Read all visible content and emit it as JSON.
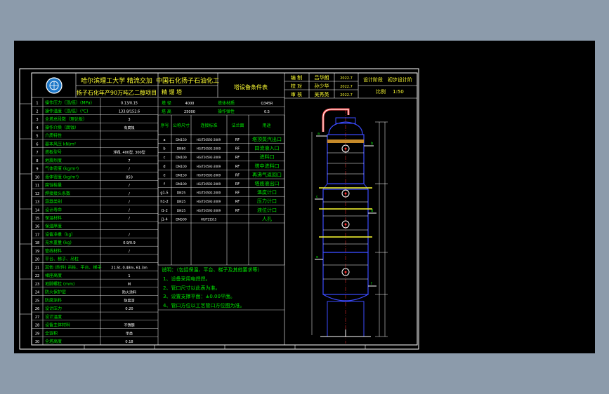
{
  "colors": {
    "background": "#8c9bab",
    "canvas": "#000000",
    "frame": "#ffffff",
    "text": "#00e600",
    "header_text": "#ffff33",
    "vessel": "#3b4bff",
    "nozzle": "#ff3030"
  },
  "title_block": {
    "university": "哈尔滨理工大学 精流交加",
    "company": "中国石化扬子石油化工",
    "project": "扬子石化年产90万吨乙二醇项目",
    "drawing_no": "精 馏 塔",
    "sheet_title": "塔设备条件表",
    "signoff": [
      {
        "role": "编 制",
        "name": "吕华朗",
        "date": "2022.7"
      },
      {
        "role": "校 对",
        "name": "孙少华",
        "date": "2022.7"
      },
      {
        "role": "审 核",
        "name": "吴秀英",
        "date": "2022.7"
      }
    ],
    "stage": "设计阶段　初步设计阶",
    "scale_label": "比例",
    "scale_value": "1:50"
  },
  "left_table": [
    {
      "no": "1",
      "label": "操作压力（顶/底）(MPa)",
      "value": "0.13/0.15"
    },
    {
      "no": "2",
      "label": "操作温度（顶/底）(℃)",
      "value": "133.8/152.6"
    },
    {
      "no": "3",
      "label": "全塔总段数（理论板）",
      "value": "3"
    },
    {
      "no": "4",
      "label": "操作介质（腐蚀）",
      "value": "有腐蚀"
    },
    {
      "no": "5",
      "label": "介质特性",
      "value": ""
    },
    {
      "no": "6",
      "label": "基本风压 kN/m²",
      "value": ""
    },
    {
      "no": "7",
      "label": "塔板型号",
      "value": "浮阀, 400型, 300型"
    },
    {
      "no": "8",
      "label": "地震烈度",
      "value": "7"
    },
    {
      "no": "9",
      "label": "气体密度 (kg/m³)",
      "value": "/"
    },
    {
      "no": "10",
      "label": "液体密度 (kg/m³)",
      "value": "850"
    },
    {
      "no": "11",
      "label": "腐蚀裕量",
      "value": "/"
    },
    {
      "no": "12",
      "label": "焊接接头系数",
      "value": "/"
    },
    {
      "no": "13",
      "label": "容器类别",
      "value": "/"
    },
    {
      "no": "14",
      "label": "设计寿命",
      "value": "/"
    },
    {
      "no": "15",
      "label": "保温材料",
      "value": "/"
    },
    {
      "no": "16",
      "label": "保温厚度",
      "value": ""
    },
    {
      "no": "17",
      "label": "设备净重（kg）",
      "value": "/"
    },
    {
      "no": "18",
      "label": "充水重量 (kg)",
      "value": "0.9/0.9"
    },
    {
      "no": "19",
      "label": "管线材料",
      "value": "/"
    },
    {
      "no": "20",
      "label": "平台、梯子、吊柱",
      "value": ""
    },
    {
      "no": "21",
      "label": "其他 (附件) 吊柱、平台、梯子",
      "value": "21.5t, 0.48m, 61.3m"
    },
    {
      "no": "22",
      "label": "裙座高度",
      "value": "1"
    },
    {
      "no": "23",
      "label": "地脚螺栓 (mm)",
      "value": "M"
    },
    {
      "no": "24",
      "label": "防火保护层",
      "value": "防火涂料"
    },
    {
      "no": "25",
      "label": "防腐涂料",
      "value": "防腐漆"
    },
    {
      "no": "26",
      "label": "设计压力",
      "value": "0.20"
    },
    {
      "no": "27",
      "label": "设计温度",
      "value": ""
    },
    {
      "no": "28",
      "label": "设备主体材料",
      "value": "不锈钢"
    },
    {
      "no": "29",
      "label": "全容积",
      "value": "甲类"
    },
    {
      "no": "30",
      "label": "全塔高度",
      "value": "0.18"
    }
  ],
  "top_right": {
    "rows": [
      {
        "label": "塔 径",
        "value": "4000",
        "label2": "塔体材质",
        "value2": "Q345R"
      },
      {
        "label": "塔 高",
        "value": "25000",
        "label2": "操作弹性",
        "value2": "0.5"
      }
    ]
  },
  "nozzle_header": [
    "序号",
    "公称尺寸",
    "连接标准",
    "法兰面",
    "用途"
  ],
  "nozzles": [
    {
      "id": "a",
      "size": "DN150",
      "std": "HG/T20592-2009",
      "face": "RF",
      "use": "塔顶蒸汽出口"
    },
    {
      "id": "b",
      "size": "DN80",
      "std": "HG/T20592-2009",
      "face": "RF",
      "use": "回流液入口"
    },
    {
      "id": "c",
      "size": "DN100",
      "std": "HG/T20592-2009",
      "face": "RF",
      "use": "进料口"
    },
    {
      "id": "d",
      "size": "DN100",
      "std": "HG/T20592-2009",
      "face": "RF",
      "use": "塔中进料口"
    },
    {
      "id": "e",
      "size": "DN150",
      "std": "HG/T20592-2009",
      "face": "RF",
      "use": "再沸气返回口"
    },
    {
      "id": "f",
      "size": "DN100",
      "std": "HG/T20592-2009",
      "face": "RF",
      "use": "塔底液出口"
    },
    {
      "id": "g1-5",
      "size": "DN25",
      "std": "HG/T20592-2009",
      "face": "RF",
      "use": "温度计口"
    },
    {
      "id": "h1-2",
      "size": "DN25",
      "std": "HG/T20592-2009",
      "face": "RF",
      "use": "压力计口"
    },
    {
      "id": "i1-2",
      "size": "DN25",
      "std": "HG/T20592-2009",
      "face": "RF",
      "use": "液位计口"
    },
    {
      "id": "j1-4",
      "size": "DN500",
      "std": "HG/T21515",
      "face": "",
      "use": "人孔"
    }
  ],
  "notes": {
    "title": "说明：（包括保温、平台、梯子及其他要求等）",
    "items": [
      "1、设备采用电焊焊。",
      "2、管口尺寸以此表为准。",
      "3、设置支撑平面：±0.00平面。",
      "4、管口方位以工艺管口方位图为准。"
    ]
  },
  "tower_labels": [
    "a",
    "b",
    "c",
    "d",
    "e",
    "f"
  ]
}
